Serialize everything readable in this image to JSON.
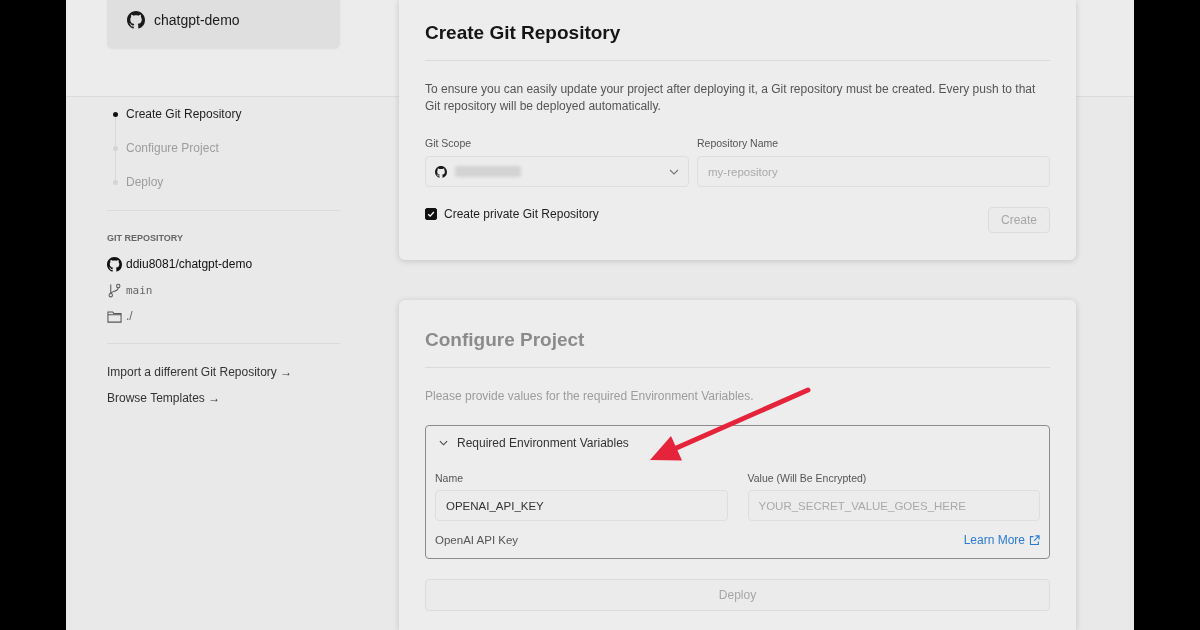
{
  "sidebar": {
    "project": {
      "name": "chatgpt-demo"
    },
    "steps": [
      {
        "label": "Create Git Repository",
        "selected": true
      },
      {
        "label": "Configure Project",
        "selected": false
      },
      {
        "label": "Deploy",
        "selected": false
      }
    ],
    "git_repository": {
      "heading": "GIT REPOSITORY",
      "repository": "ddiu8081/chatgpt-demo",
      "branch": "main",
      "root_directory": "./"
    },
    "links": [
      "Import a different Git Repository →",
      "Browse Templates →"
    ]
  },
  "create_git_repository": {
    "title": "Create Git Repository",
    "description": "To ensure you can easily update your project after deploying it, a Git repository must be created. Every push to that Git repository will be deployed automatically.",
    "git_scope": {
      "label": "Git Scope"
    },
    "repository_name": {
      "label": "Repository Name",
      "placeholder": "my-repository"
    },
    "private_checkbox": {
      "label": "Create private Git Repository",
      "checked": true
    },
    "create_button": {
      "label": "Create",
      "disabled": true
    }
  },
  "configure_project": {
    "title": "Configure Project",
    "disabled": true,
    "description": "Please provide values for the required Environment Variables.",
    "environment_variables": {
      "title": "Required Environment Variables",
      "expanded": true,
      "name_label": "Name",
      "value_label": "Value (Will Be Encrypted)",
      "variables": [
        {
          "name": "OPENAI_API_KEY",
          "placeholder": "YOUR_SECRET_VALUE_GOES_HERE",
          "description": "OpenAI API Key"
        }
      ],
      "learn_more": "Learn More"
    },
    "deploy_button": {
      "label": "Deploy",
      "disabled": true
    }
  }
}
